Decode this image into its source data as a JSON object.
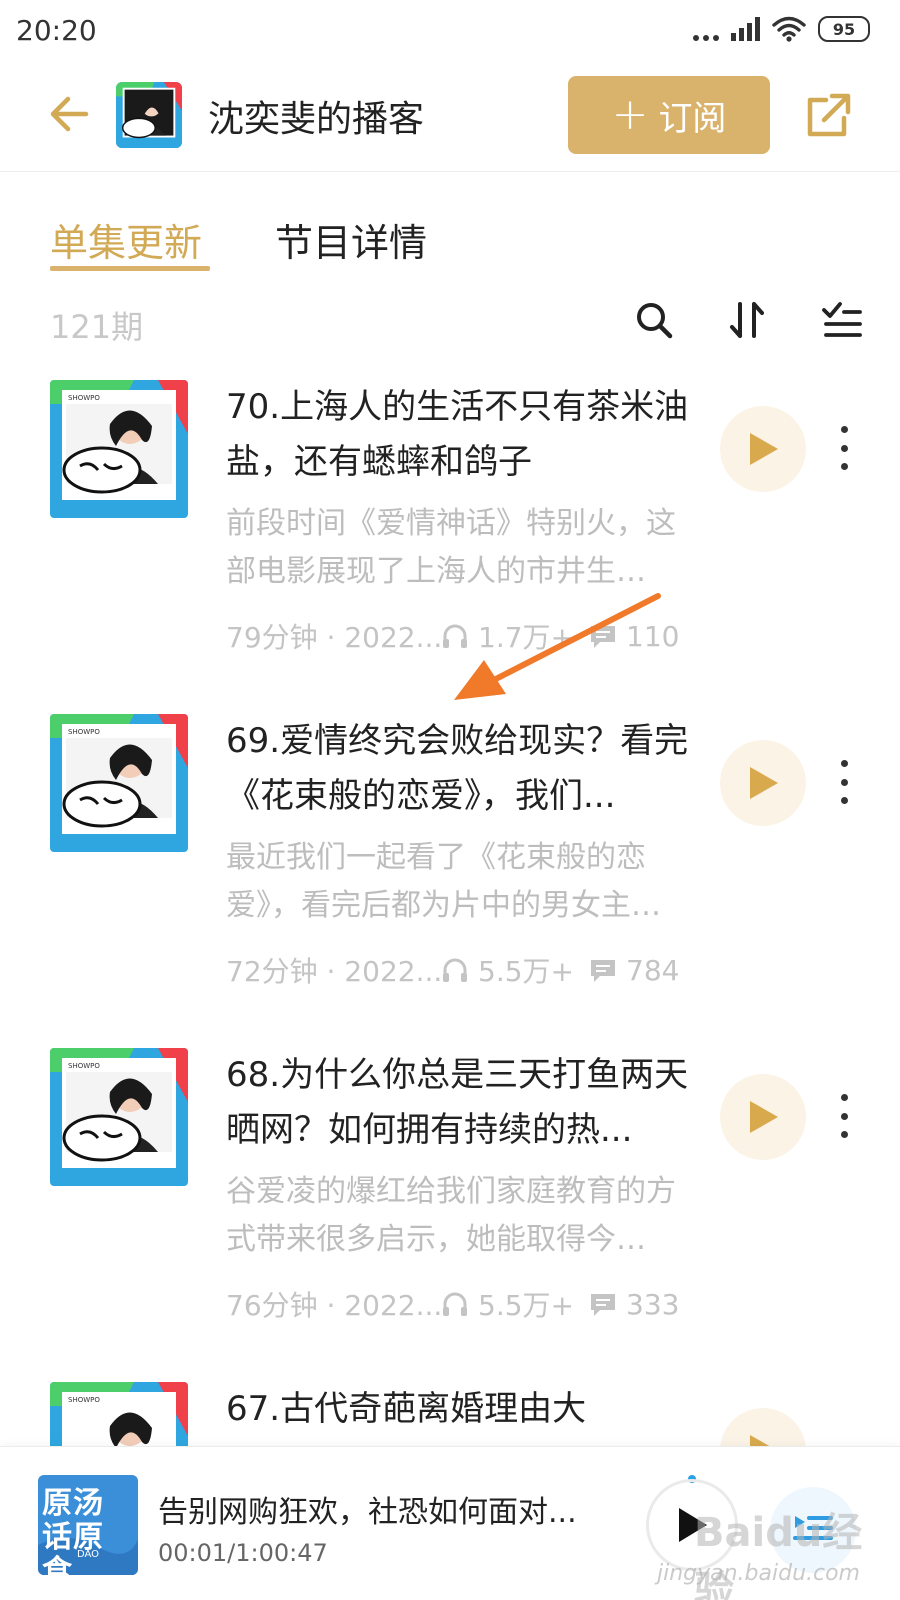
{
  "status_bar": {
    "time": "20:20",
    "battery": "95"
  },
  "header": {
    "title": "沈奕斐的播客",
    "subscribe_label": "订阅"
  },
  "tabs": [
    {
      "label": "单集更新",
      "active": true
    },
    {
      "label": "节目详情",
      "active": false
    }
  ],
  "toolbar": {
    "count": "121期"
  },
  "episodes": [
    {
      "title": " 70.上海人的生活不只有茶米油盐，还有蟋蟀和鸽子",
      "description": "前段时间《爱情神话》特别火，这部电影展现了上海人的市井生…",
      "duration_date": "79分钟 · 2022...",
      "plays": "1.7万+",
      "comments": "110"
    },
    {
      "title": "69.爱情终究会败给现实？看完《花束般的恋爱》，我们...",
      "description": "最近我们一起看了《花束般的恋爱》，看完后都为片中的男女主…",
      "duration_date": "72分钟 · 2022...",
      "plays": "5.5万+",
      "comments": "784"
    },
    {
      "title": "68.为什么你总是三天打鱼两天晒网？如何拥有持续的热...",
      "description": "谷爱凌的爆红给我们家庭教育的方式带来很多启示，她能取得今…",
      "duration_date": "76分钟 · 2022...",
      "plays": "5.5万+",
      "comments": "333"
    },
    {
      "title": "67.古代奇葩离婚理由大",
      "description": "",
      "duration_date": "",
      "plays": "",
      "comments": ""
    }
  ],
  "mini_player": {
    "title": "告别网购狂欢，社恐如何面对...",
    "time": "00:01/1:00:47",
    "cover_text": "原汤话原食"
  },
  "colors": {
    "accent": "#d9b26b",
    "tab_active": "#d2a955",
    "arrow": "#f07a2a"
  },
  "watermark": {
    "logo": "Baidu经验",
    "url": "jingyan.baidu.com"
  }
}
